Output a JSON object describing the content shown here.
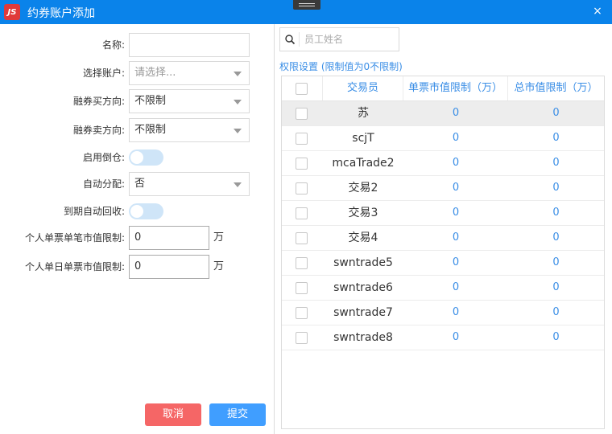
{
  "window": {
    "title": "约券账户添加",
    "close_icon": "×",
    "logo_text": "JS"
  },
  "form": {
    "name": {
      "label": "名称:",
      "value": ""
    },
    "account": {
      "label": "选择账户:",
      "placeholder": "请选择..."
    },
    "buy_direction": {
      "label": "融券买方向:",
      "value": "不限制"
    },
    "sell_direction": {
      "label": "融券卖方向:",
      "value": "不限制"
    },
    "enable_cover": {
      "label": "启用倒仓:",
      "on": false
    },
    "auto_allocate": {
      "label": "自动分配:",
      "value": "否"
    },
    "auto_recall": {
      "label": "到期自动回收:",
      "on": false
    },
    "single_order_limit": {
      "label": "个人单票单笔市值限制:",
      "value": "0",
      "unit": "万"
    },
    "daily_limit": {
      "label": "个人单日单票市值限制:",
      "value": "0",
      "unit": "万"
    }
  },
  "buttons": {
    "cancel": "取消",
    "submit": "提交"
  },
  "colors": {
    "titlebar": "#0a83ea",
    "accent": "#3a8ee6",
    "cancel": "#f56666",
    "submit": "#409eff"
  },
  "search": {
    "placeholder": "员工姓名"
  },
  "permissions": {
    "title": "权限设置 (限制值为0不限制)",
    "columns": [
      "交易员",
      "单票市值限制（万）",
      "总市值限制（万）"
    ],
    "rows": [
      {
        "trader": "苏",
        "single": "0",
        "total": "0",
        "selected": true
      },
      {
        "trader": "scjT",
        "single": "0",
        "total": "0"
      },
      {
        "trader": "mcaTrade2",
        "single": "0",
        "total": "0"
      },
      {
        "trader": "交易2",
        "single": "0",
        "total": "0"
      },
      {
        "trader": "交易3",
        "single": "0",
        "total": "0"
      },
      {
        "trader": "交易4",
        "single": "0",
        "total": "0"
      },
      {
        "trader": "swntrade5",
        "single": "0",
        "total": "0"
      },
      {
        "trader": "swntrade6",
        "single": "0",
        "total": "0"
      },
      {
        "trader": "swntrade7",
        "single": "0",
        "total": "0"
      },
      {
        "trader": "swntrade8",
        "single": "0",
        "total": "0"
      }
    ]
  }
}
